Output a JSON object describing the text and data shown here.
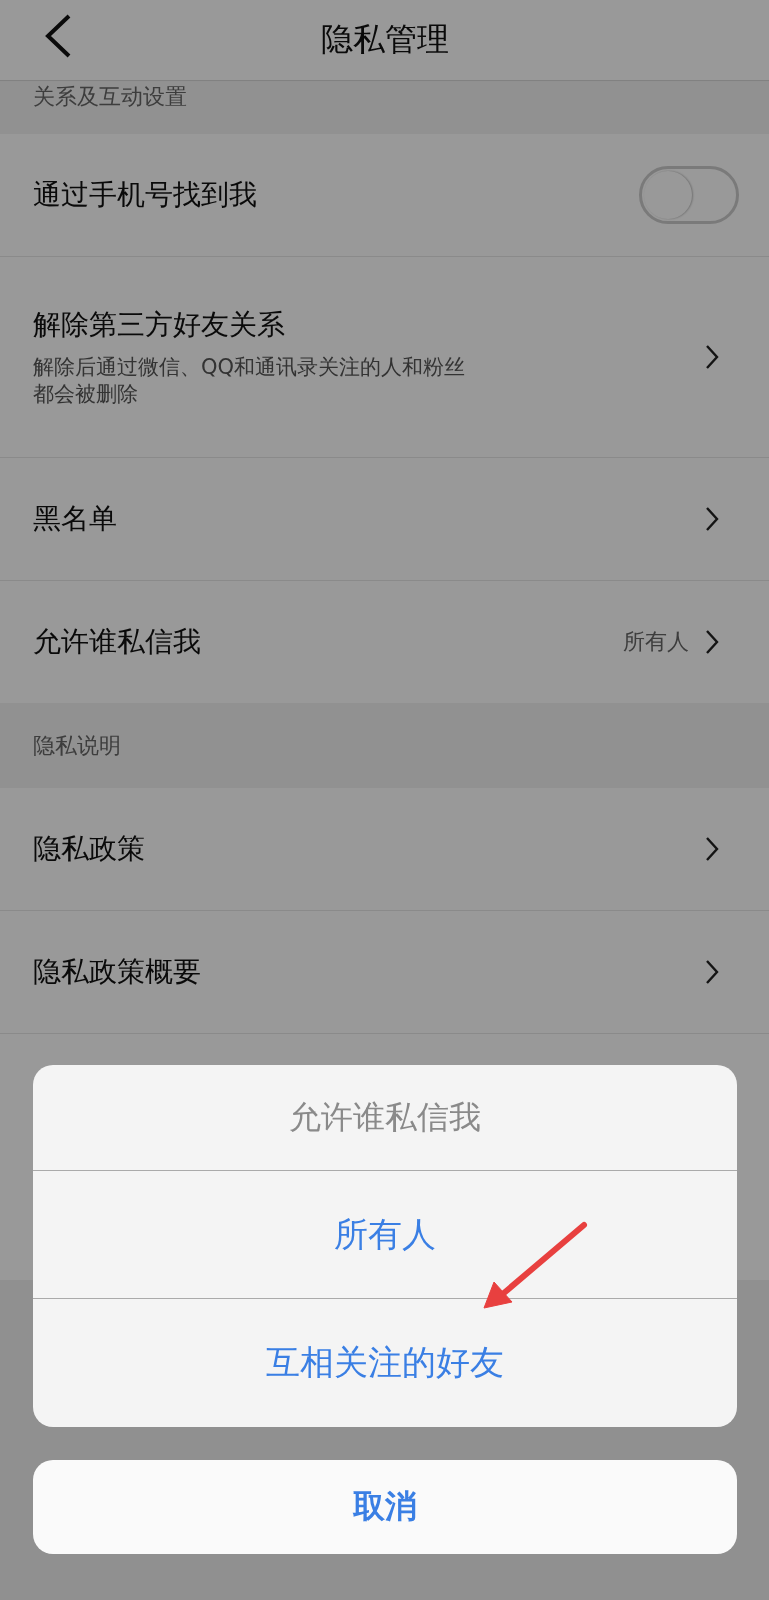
{
  "header": {
    "title": "隐私管理"
  },
  "sections": [
    {
      "title": "关系及互动设置",
      "rows": [
        {
          "kind": "toggle",
          "label": "通过手机号找到我",
          "on": false
        },
        {
          "kind": "link",
          "label": "解除第三方好友关系",
          "description": "解除后通过微信、QQ和通讯录关注的人和粉丝都会被删除"
        },
        {
          "kind": "link",
          "label": "黑名单"
        },
        {
          "kind": "link",
          "label": "允许谁私信我",
          "value": "所有人"
        }
      ]
    },
    {
      "title": "隐私说明",
      "rows": [
        {
          "kind": "link",
          "label": "隐私政策"
        },
        {
          "kind": "link",
          "label": "隐私政策概要"
        }
      ]
    }
  ],
  "action_sheet": {
    "title": "允许谁私信我",
    "options": [
      "所有人",
      "互相关注的好友"
    ],
    "cancel": "取消"
  }
}
